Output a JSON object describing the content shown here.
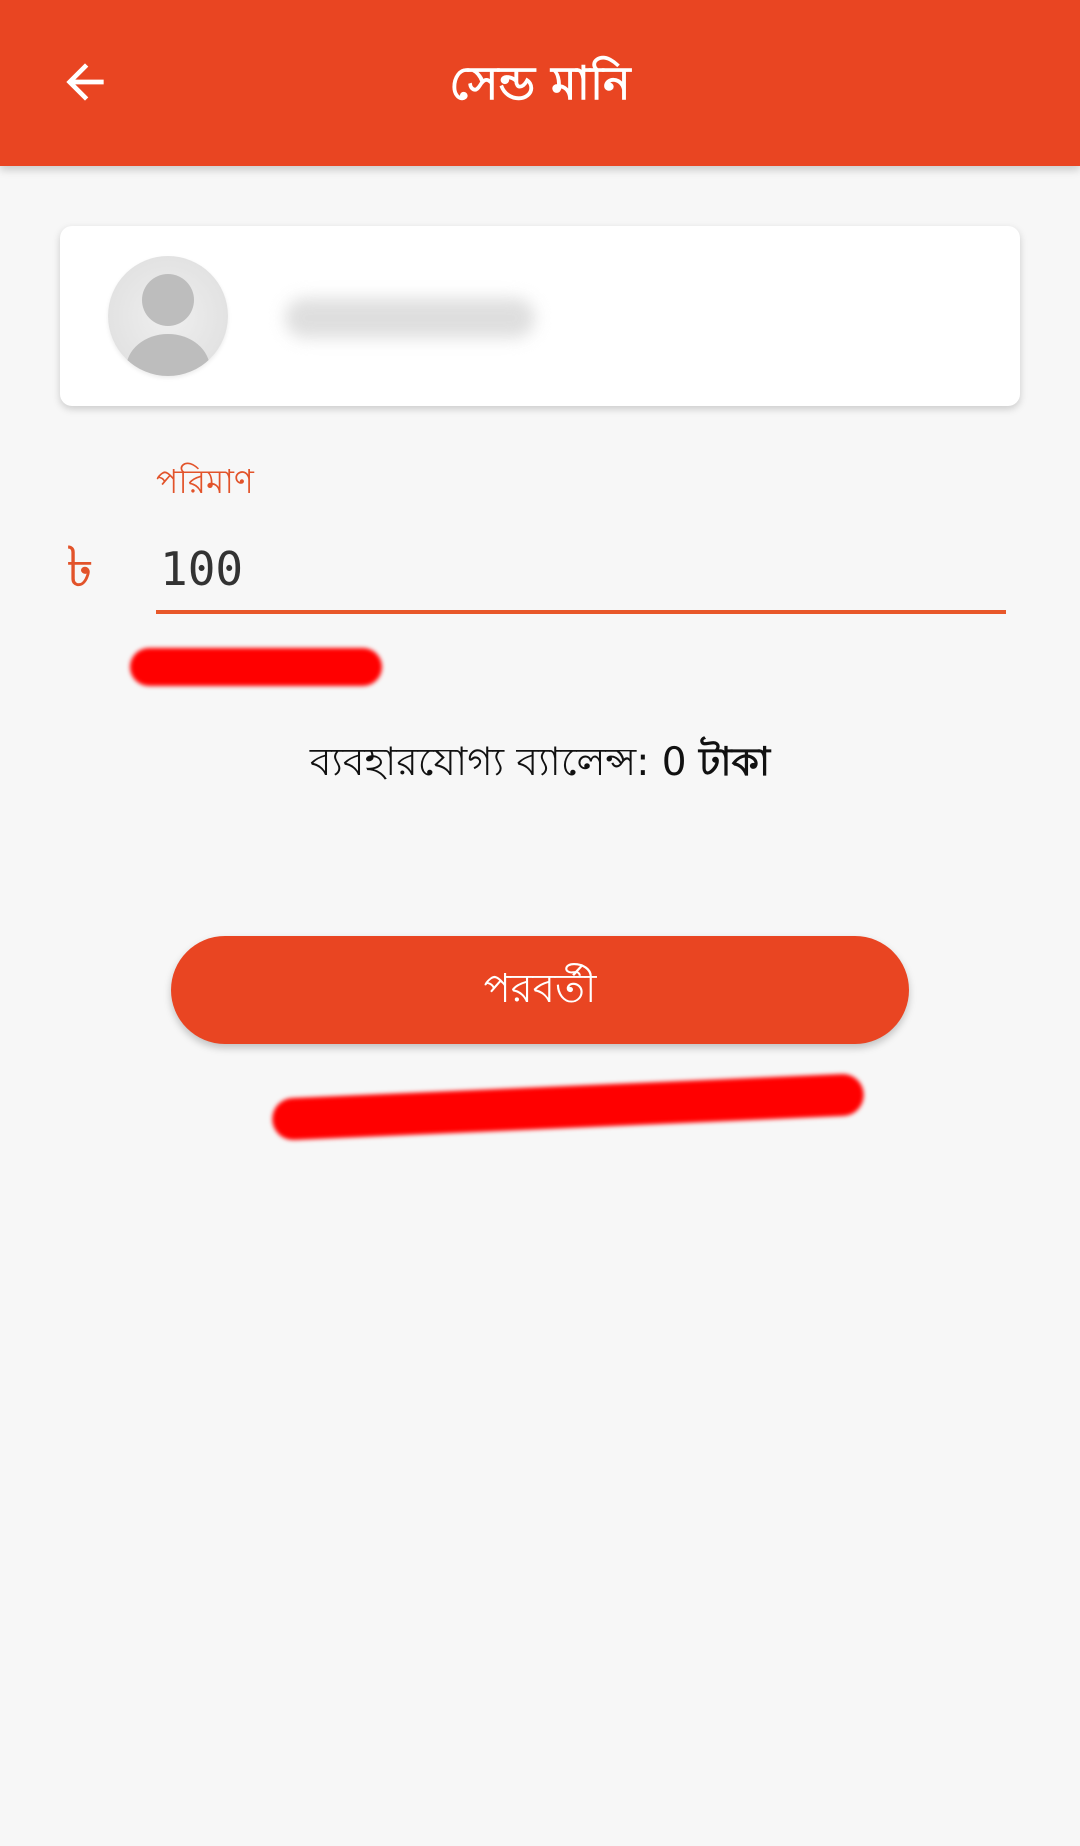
{
  "app_bar": {
    "title": "সেন্ড মানি"
  },
  "form": {
    "amount_label": "পরিমাণ",
    "currency_symbol": "৳",
    "amount_value": "100"
  },
  "balance": {
    "label": "ব্যবহারযোগ্য ব্যালেন্স:",
    "value": "0",
    "unit": "টাকা"
  },
  "actions": {
    "next_label": "পরবর্তী"
  },
  "colors": {
    "primary": "#e94522",
    "accent_text": "#e2532a",
    "background": "#f7f7f7",
    "redaction": "#ff0000"
  }
}
